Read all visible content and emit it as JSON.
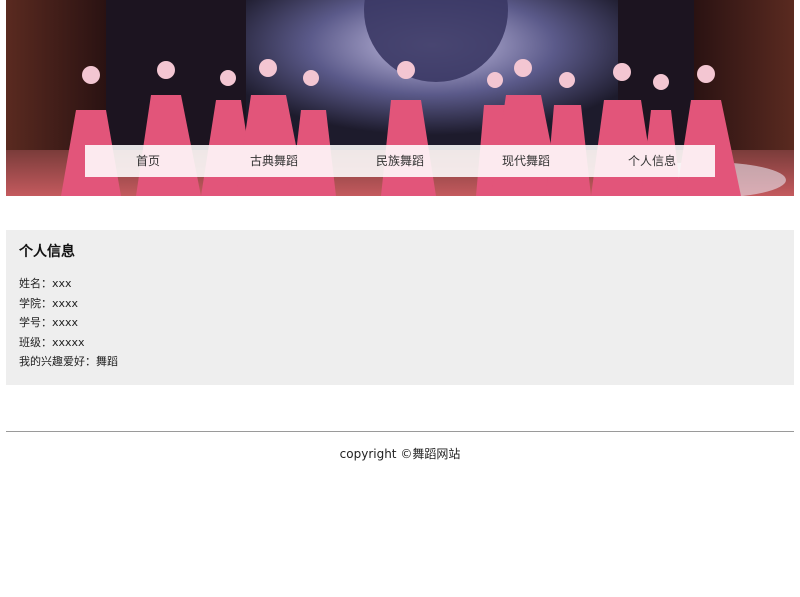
{
  "banner": {
    "alt": "dance performance stage photo"
  },
  "nav": {
    "items": [
      {
        "label": "首页"
      },
      {
        "label": "古典舞蹈"
      },
      {
        "label": "民族舞蹈"
      },
      {
        "label": "现代舞蹈"
      },
      {
        "label": "个人信息"
      }
    ]
  },
  "info": {
    "title": "个人信息",
    "rows": [
      {
        "text": "姓名：xxx"
      },
      {
        "text": "学院：xxxx"
      },
      {
        "text": "学号：xxxx"
      },
      {
        "text": "班级：xxxxx"
      },
      {
        "text": "我的兴趣爱好：舞蹈"
      }
    ]
  },
  "footer": {
    "copyright": "copyright ©舞蹈网站"
  }
}
